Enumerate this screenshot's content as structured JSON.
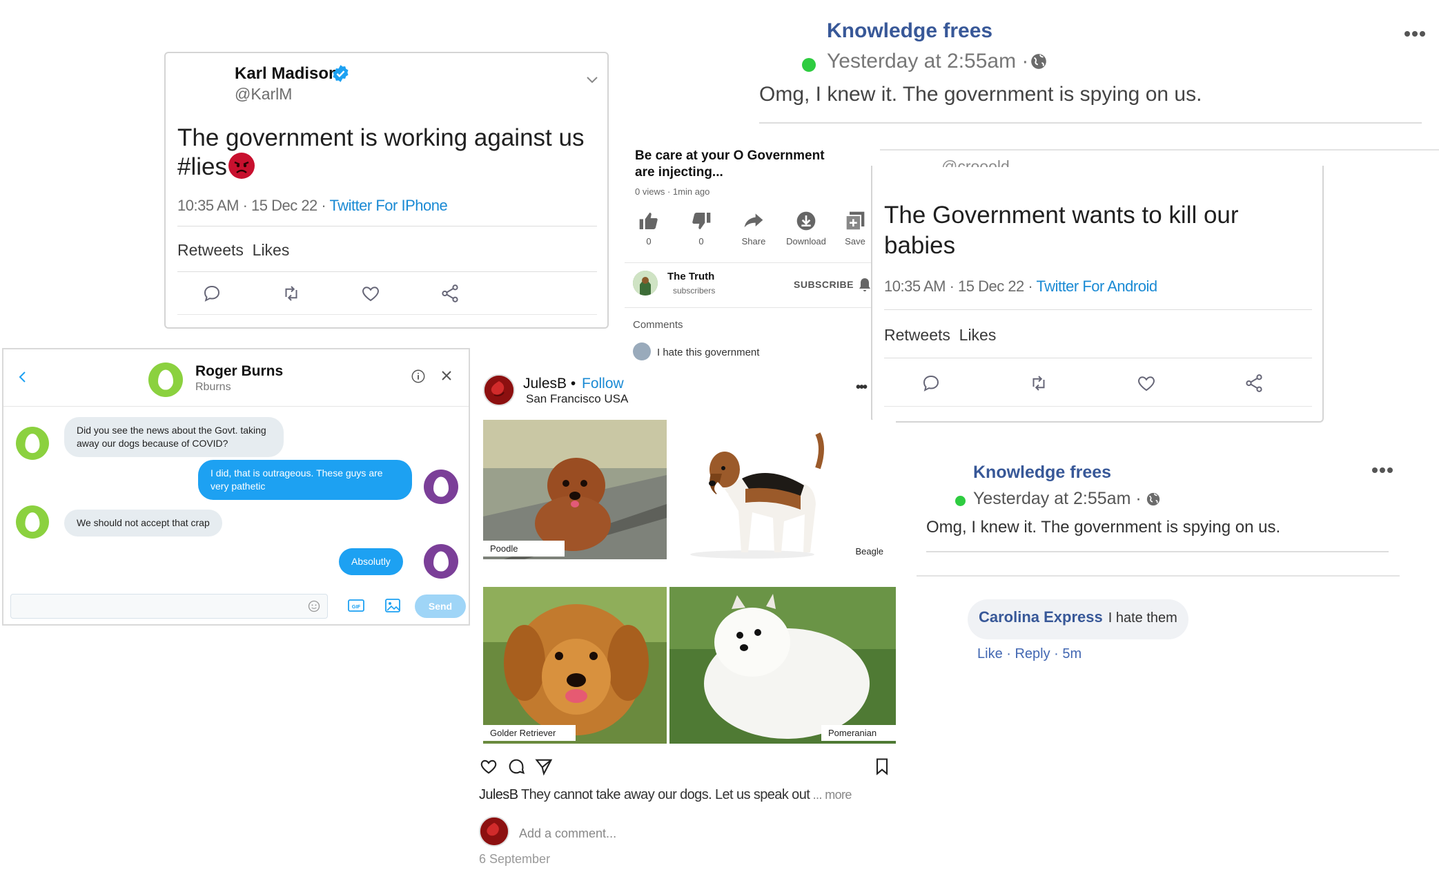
{
  "tweet1": {
    "name": "Karl Madison",
    "handle": "@KarlM",
    "text": "The government is working against us #lies",
    "time": "10:35 AM · 15 Dec 22 · ",
    "source": "Twitter For IPhone",
    "stats": "Retweets  Likes"
  },
  "fb_top": {
    "author": "Knowledge frees",
    "time": "Yesterday at 2:55am ·",
    "text": "Omg, I knew it. The government is spying on us."
  },
  "video": {
    "title": "Be care at your O Government are injecting...",
    "meta": "0 views  · 1min ago",
    "buttons": [
      {
        "label": "0",
        "icon": "thumbs-up-icon"
      },
      {
        "label": "0",
        "icon": "thumbs-down-icon"
      },
      {
        "label": "Share",
        "icon": "share-arrow-icon"
      },
      {
        "label": "Download",
        "icon": "download-icon"
      },
      {
        "label": "Save",
        "icon": "save-playlist-icon"
      }
    ],
    "channel": "The Truth",
    "subscribers": "subscribers",
    "subscribe": "SUBSCRIBE",
    "comments_label": "Comments",
    "comment": "I hate this government"
  },
  "tweet2": {
    "handle_partial": "@crooold",
    "text": "The Government wants to kill our babies",
    "time": "10:35 AM · 15 Dec 22 · ",
    "source": "Twitter For Android",
    "stats": "Retweets  Likes"
  },
  "chat": {
    "name": "Roger Burns",
    "handle": "Rburns",
    "messages": [
      {
        "from": "in",
        "text": "Did you see the news about the Govt. taking away our dogs because of COVID?"
      },
      {
        "from": "out",
        "text": "I did, that is outrageous. These guys are very pathetic"
      },
      {
        "from": "in",
        "text": "We should not accept that crap"
      },
      {
        "from": "out",
        "text": "Absolutly"
      }
    ],
    "send": "Send",
    "gif": "GIF"
  },
  "insta": {
    "user": "JulesB",
    "bullet": "•",
    "follow": "Follow",
    "location": "San Francisco USA",
    "images": [
      {
        "label": "Poodle"
      },
      {
        "label": "Beagle"
      },
      {
        "label": "Golder Retriever"
      },
      {
        "label": "Pomeranian"
      }
    ],
    "caption_user": "JulesB",
    "caption": " They cannot take away our dogs. Let us speak out",
    "more": " ... more",
    "add_comment": "Add a comment...",
    "date": "6 September"
  },
  "fb_bottom": {
    "author": "Knowledge frees",
    "time": "Yesterday at 2:55am ·",
    "text": "Omg, I knew it. The government is spying on us.",
    "comment_author": "Carolina Express",
    "comment_text": "I hate them",
    "like": "Like",
    "reply": "Reply",
    "ago": "5m"
  },
  "colors": {
    "twitter_blue": "#1da1f2",
    "facebook_blue": "#385898",
    "online_green": "#2ecc40",
    "egg_green": "#8bd13f",
    "egg_purple": "#7b3f98"
  }
}
